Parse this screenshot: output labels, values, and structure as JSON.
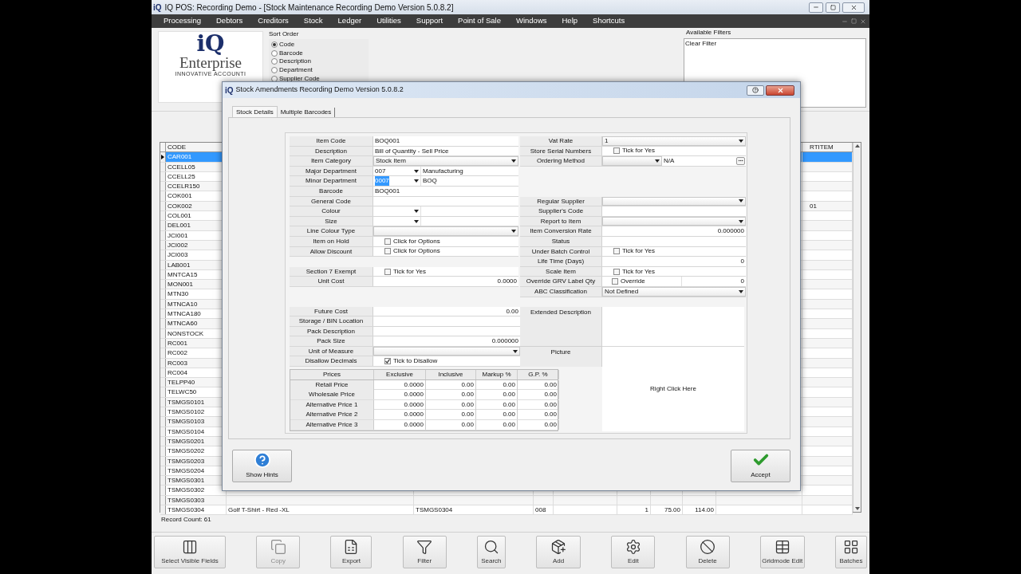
{
  "window": {
    "app_icon": "iQ",
    "title": "IQ POS: Recording Demo - [Stock Maintenance Recording Demo Version 5.0.8.2]"
  },
  "menu": [
    "Processing",
    "Debtors",
    "Creditors",
    "Stock",
    "Ledger",
    "Utilities",
    "Support",
    "Point of Sale",
    "Windows",
    "Help",
    "Shortcuts"
  ],
  "logo": {
    "mark": "iQ",
    "name": "Enterprise",
    "tagline": "INNOVATIVE ACCOUNTI"
  },
  "sort_order": {
    "title": "Sort Order",
    "options": [
      {
        "label": "Code",
        "selected": true
      },
      {
        "label": "Barcode",
        "selected": false
      },
      {
        "label": "Description",
        "selected": false
      },
      {
        "label": "Department",
        "selected": false
      },
      {
        "label": "Supplier Code",
        "selected": false
      }
    ]
  },
  "filters": {
    "title": "Available Filters",
    "items": [
      "Clear Filter"
    ]
  },
  "grid": {
    "columns": {
      "code": "CODE",
      "column_10": "RTITEM"
    },
    "rows": [
      {
        "code": "CAR001",
        "selected": true
      },
      {
        "code": "CCELL05",
        "selected": false
      },
      {
        "code": "CCELL25",
        "selected": false
      },
      {
        "code": "CCELR150",
        "selected": false
      },
      {
        "code": "COK001",
        "selected": false
      },
      {
        "code": "COK002",
        "selected": false,
        "column_10": "01"
      },
      {
        "code": "COL001",
        "selected": false
      },
      {
        "code": "DEL001",
        "selected": false
      },
      {
        "code": "JCI001",
        "selected": false
      },
      {
        "code": "JCI002",
        "selected": false
      },
      {
        "code": "JCI003",
        "selected": false
      },
      {
        "code": "LAB001",
        "selected": false
      },
      {
        "code": "MNTCA15",
        "selected": false
      },
      {
        "code": "MON001",
        "selected": false
      },
      {
        "code": "MTN30",
        "selected": false
      },
      {
        "code": "MTNCA10",
        "selected": false
      },
      {
        "code": "MTNCA180",
        "selected": false
      },
      {
        "code": "MTNCA60",
        "selected": false
      },
      {
        "code": "NONSTOCK",
        "selected": false
      },
      {
        "code": "RC001",
        "selected": false
      },
      {
        "code": "RC002",
        "selected": false
      },
      {
        "code": "RC003",
        "selected": false
      },
      {
        "code": "RC004",
        "selected": false
      },
      {
        "code": "TELPP40",
        "selected": false
      },
      {
        "code": "TELWC50",
        "selected": false
      },
      {
        "code": "TSMGS0101",
        "selected": false
      },
      {
        "code": "TSMGS0102",
        "selected": false
      },
      {
        "code": "TSMGS0103",
        "selected": false
      },
      {
        "code": "TSMGS0104",
        "selected": false
      },
      {
        "code": "TSMGS0201",
        "selected": false
      },
      {
        "code": "TSMGS0202",
        "selected": false
      },
      {
        "code": "TSMGS0203",
        "selected": false
      },
      {
        "code": "TSMGS0204",
        "selected": false
      },
      {
        "code": "TSMGS0301",
        "selected": false
      },
      {
        "code": "TSMGS0302",
        "selected": false
      },
      {
        "code": "TSMGS0303",
        "selected": false
      },
      {
        "code": "TSMGS0304",
        "selected": false,
        "description": "Golf T-Shirt - Red -XL",
        "barcode": "TSMGS0304",
        "department": "008",
        "column_6": "1",
        "column_7": "75.00",
        "column_8": "114.00"
      }
    ],
    "record_count": "Record Count: 61"
  },
  "toolbar": [
    {
      "kind": "fields",
      "label": "Select Visible Fields",
      "disabled": false
    },
    {
      "kind": "copy",
      "label": "Copy",
      "disabled": true
    },
    {
      "kind": "export",
      "label": "Export",
      "disabled": false
    },
    {
      "kind": "filter",
      "label": "Filter",
      "disabled": false
    },
    {
      "kind": "search",
      "label": "Search",
      "disabled": false
    },
    {
      "kind": "add",
      "label": "Add",
      "disabled": false
    },
    {
      "kind": "edit",
      "label": "Edit",
      "disabled": false
    },
    {
      "kind": "delete",
      "label": "Delete",
      "disabled": false
    },
    {
      "kind": "gridmode",
      "label": "Gridmode Edit",
      "disabled": false
    },
    {
      "kind": "batches",
      "label": "Batches",
      "disabled": false
    }
  ],
  "dialog": {
    "app_icon": "iQ",
    "title": "Stock Amendments Recording Demo Version 5.0.8.2",
    "tabs": [
      {
        "label": "Stock Details",
        "selected": true
      },
      {
        "label": "Multiple Barcodes",
        "selected": false
      }
    ],
    "left": [
      {
        "kind": "text",
        "label": "Item Code",
        "value": "BOQ001"
      },
      {
        "kind": "text",
        "label": "Description",
        "value": "Bill of Quantity - Sell Price"
      },
      {
        "kind": "select",
        "label": "Item Category",
        "value": "Stock Item"
      },
      {
        "kind": "dept",
        "label": "Major Department",
        "code": "007",
        "name": "Manufacturing",
        "highlighted": false
      },
      {
        "kind": "dept",
        "label": "Minor Department",
        "code": "0007",
        "name": "BOQ",
        "highlighted": true
      },
      {
        "kind": "text",
        "label": "Barcode",
        "value": "BOQ001"
      },
      {
        "kind": "text",
        "label": "General Code"
      },
      {
        "kind": "dept",
        "label": "Colour"
      },
      {
        "kind": "dept",
        "label": "Size"
      },
      {
        "kind": "select",
        "label": "Line Colour Type"
      },
      {
        "kind": "checkbox",
        "label": "Item on Hold",
        "text": "Click for Options",
        "checked": false
      },
      {
        "kind": "checkbox",
        "label": "Allow Discount",
        "text": "Click for Options",
        "checked": false
      },
      {
        "kind": "spacer"
      },
      {
        "kind": "checkbox",
        "label": "Section 7 Exempt",
        "text": "Tick for Yes",
        "checked": false
      },
      {
        "kind": "number",
        "label": "Unit Cost",
        "value": "0.0000"
      }
    ],
    "right": [
      {
        "kind": "select",
        "label": "Vat Rate",
        "value": "1"
      },
      {
        "kind": "checkbox",
        "label": "Store Serial Numbers",
        "text": "Tick for Yes",
        "checked": false
      },
      {
        "kind": "ordering",
        "label": "Ordering Method",
        "value": "N/A"
      },
      {
        "kind": "spacer"
      },
      {
        "kind": "spacer"
      },
      {
        "kind": "spacer"
      },
      {
        "kind": "select",
        "label": "Regular Supplier"
      },
      {
        "kind": "text",
        "label": "Supplier's Code"
      },
      {
        "kind": "select",
        "label": "Report to Item"
      },
      {
        "kind": "number",
        "label": "Item Conversion Rate",
        "value": "0.000000"
      },
      {
        "kind": "text",
        "label": "Status"
      },
      {
        "kind": "checkbox",
        "label": "Under Batch Control",
        "text": "Tick for Yes",
        "checked": false
      },
      {
        "kind": "number",
        "label": "Life Time (Days)",
        "value": "0"
      },
      {
        "kind": "checkbox",
        "label": "Scale Item",
        "text": "Tick for Yes",
        "checked": false
      },
      {
        "kind": "override",
        "label": "Override GRV Label Qty",
        "text": "Override",
        "checked": false,
        "value": "0"
      },
      {
        "kind": "select",
        "label": "ABC Classification",
        "value": "Not Defined"
      }
    ],
    "lower_left": [
      {
        "kind": "number",
        "label": "Future Cost",
        "value": "0.00"
      },
      {
        "kind": "text",
        "label": "Storage / BIN Location"
      },
      {
        "kind": "text",
        "label": "Pack Description"
      },
      {
        "kind": "number",
        "label": "Pack Size",
        "value": "0.000000"
      },
      {
        "kind": "select",
        "label": "Unit of Measure"
      },
      {
        "kind": "checkbox",
        "label": "Disallow Decimals",
        "text": "Tick to Disallow",
        "checked": true
      }
    ],
    "prices": {
      "columns": [
        "Prices",
        "Exclusive",
        "Inclusive",
        "Markup %",
        "G.P. %"
      ],
      "rows": [
        {
          "label": "Retail Price",
          "values": [
            "0.0000",
            "0.00",
            "0.00",
            "0.00"
          ]
        },
        {
          "label": "Wholesale Price",
          "values": [
            "0.0000",
            "0.00",
            "0.00",
            "0.00"
          ]
        },
        {
          "label": "Alternative Price 1",
          "values": [
            "0.0000",
            "0.00",
            "0.00",
            "0.00"
          ]
        },
        {
          "label": "Alternative Price 2",
          "values": [
            "0.0000",
            "0.00",
            "0.00",
            "0.00"
          ]
        },
        {
          "label": "Alternative Price 3",
          "values": [
            "0.0000",
            "0.00",
            "0.00",
            "0.00"
          ]
        }
      ]
    },
    "extended_description": {
      "label": "Extended Description"
    },
    "picture": {
      "label": "Picture",
      "hint": "Right Click Here"
    },
    "buttons": [
      {
        "kind": "hints",
        "label": "Show Hints"
      },
      {
        "kind": "accept",
        "label": "Accept"
      }
    ]
  }
}
